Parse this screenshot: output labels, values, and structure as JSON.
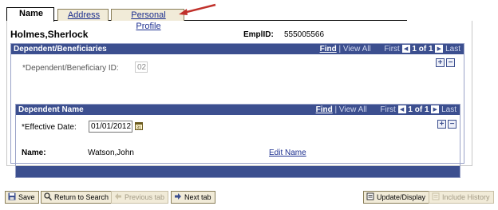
{
  "tabs": [
    {
      "label": "Name",
      "active": true
    },
    {
      "label": "Address",
      "active": false
    },
    {
      "label": "Personal Profile",
      "active": false
    }
  ],
  "employee": {
    "name": "Holmes,Sherlock",
    "id_label": "EmplID:",
    "id_value": "555005566"
  },
  "dependents": {
    "title": "Dependent/Beneficiaries",
    "nav": {
      "find": "Find",
      "view_all": "View All",
      "first": "First",
      "count": "1 of 1",
      "last": "Last"
    },
    "id_label": "*Dependent/Beneficiary ID:",
    "id_value": "02"
  },
  "dependent_name": {
    "title": "Dependent Name",
    "nav": {
      "find": "Find",
      "view_all": "View All",
      "first": "First",
      "count": "1 of 1",
      "last": "Last"
    },
    "effective_date_label": "*Effective Date:",
    "effective_date_value": "01/01/2012",
    "name_label": "Name:",
    "name_value": "Watson,John",
    "edit_name": "Edit Name"
  },
  "toolbar": {
    "save": "Save",
    "return_to_search": "Return to Search",
    "previous_tab": "Previous tab",
    "next_tab": "Next tab",
    "update_display": "Update/Display",
    "include_history": "Include History"
  },
  "colors": {
    "header": "#3c4f8f",
    "tab_bg": "#f1ebd8",
    "arrow": "#c0302a"
  }
}
